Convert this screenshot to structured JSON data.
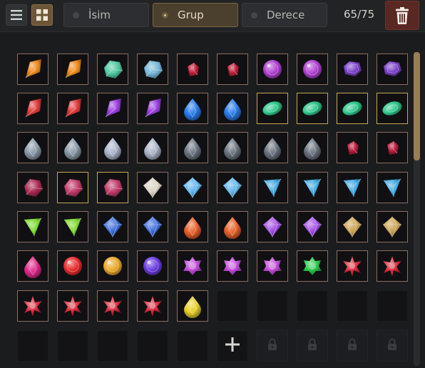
{
  "toolbar": {
    "list_view_icon": "list-icon",
    "grid_view_icon": "grid-icon",
    "sort_options": [
      {
        "label": "İsim",
        "active": false
      },
      {
        "label": "Grup",
        "active": true
      },
      {
        "label": "Derece",
        "active": false
      }
    ],
    "count": "65/75",
    "delete_icon": "trash-icon"
  },
  "colors": {
    "accent": "#8d7249",
    "delete": "#5a2822",
    "slot_border": "#8a6e60",
    "slot_highlight": "#c6a85a"
  },
  "inventory": {
    "add_slot_icon": "plus-icon",
    "locked_slot_icon": "lock-icon",
    "rows": [
      [
        {
          "name": "amber-crystal",
          "color": "#f08a1c",
          "shape": "shard"
        },
        {
          "name": "amber-crystal",
          "color": "#f08a1c",
          "shape": "shard"
        },
        {
          "name": "green-blue-ore",
          "color": "#4fc8a0",
          "shape": "chunk"
        },
        {
          "name": "blue-green-ore",
          "color": "#78b8d8",
          "shape": "chunk"
        },
        {
          "name": "dark-ruby-shard",
          "color": "#c0203a",
          "shape": "small"
        },
        {
          "name": "dark-ruby-shard",
          "color": "#c0203a",
          "shape": "small"
        },
        {
          "name": "amethyst-orb",
          "color": "#b040d0",
          "shape": "orb"
        },
        {
          "name": "amethyst-orb",
          "color": "#b040d0",
          "shape": "orb"
        },
        {
          "name": "purple-hexagon",
          "color": "#7a3ec8",
          "shape": "hex"
        },
        {
          "name": "purple-hexagon",
          "color": "#7a3ec8",
          "shape": "hex"
        }
      ],
      [
        {
          "name": "red-crystal",
          "color": "#e03a3a",
          "shape": "shard"
        },
        {
          "name": "red-crystal",
          "color": "#e03a3a",
          "shape": "shard"
        },
        {
          "name": "violet-crystal",
          "color": "#9b3fe0",
          "shape": "shard"
        },
        {
          "name": "violet-crystal",
          "color": "#9b3fe0",
          "shape": "shard"
        },
        {
          "name": "blue-teardrop",
          "color": "#2a7be8",
          "shape": "drop"
        },
        {
          "name": "blue-teardrop",
          "color": "#2a7be8",
          "shape": "drop"
        },
        {
          "name": "emerald-marquise",
          "color": "#2fc88c",
          "shape": "oval",
          "highlight": true
        },
        {
          "name": "emerald-marquise",
          "color": "#2fc88c",
          "shape": "oval",
          "highlight": true
        },
        {
          "name": "emerald-marquise",
          "color": "#2fc88c",
          "shape": "oval",
          "highlight": true
        },
        {
          "name": "emerald-marquise",
          "color": "#2fc88c",
          "shape": "oval",
          "highlight": true
        }
      ],
      [
        {
          "name": "grey-teardrop",
          "color": "#8a9aa8",
          "shape": "drop"
        },
        {
          "name": "grey-teardrop",
          "color": "#8a9aa8",
          "shape": "drop"
        },
        {
          "name": "silver-teardrop",
          "color": "#aab4c8",
          "shape": "drop"
        },
        {
          "name": "silver-teardrop",
          "color": "#aab4c8",
          "shape": "drop"
        },
        {
          "name": "dark-teardrop",
          "color": "#6c7480",
          "shape": "drop"
        },
        {
          "name": "dark-teardrop",
          "color": "#6c7480",
          "shape": "drop"
        },
        {
          "name": "dark-teardrop",
          "color": "#6c7480",
          "shape": "drop"
        },
        {
          "name": "dark-teardrop",
          "color": "#6c7480",
          "shape": "drop"
        },
        {
          "name": "blood-shards",
          "color": "#b81c3c",
          "shape": "small"
        },
        {
          "name": "blood-shards",
          "color": "#b81c3c",
          "shape": "small"
        }
      ],
      [
        {
          "name": "garnet-chunk",
          "color": "#a82850",
          "shape": "chunk"
        },
        {
          "name": "garnet-chunk",
          "color": "#c03a6a",
          "shape": "chunk",
          "highlight": true
        },
        {
          "name": "garnet-chunk",
          "color": "#c03a6a",
          "shape": "chunk",
          "highlight": true
        },
        {
          "name": "white-diamond",
          "color": "#d8d0c0",
          "shape": "diamond"
        },
        {
          "name": "blue-diamond",
          "color": "#5ab0e8",
          "shape": "diamond"
        },
        {
          "name": "blue-diamond",
          "color": "#5ab0e8",
          "shape": "diamond"
        },
        {
          "name": "cyan-trillion",
          "color": "#3ea8e0",
          "shape": "trillion"
        },
        {
          "name": "cyan-trillion",
          "color": "#3ea8e0",
          "shape": "trillion"
        },
        {
          "name": "cyan-trillion",
          "color": "#3ea8e0",
          "shape": "trillion"
        },
        {
          "name": "cyan-trillion",
          "color": "#3ea8e0",
          "shape": "trillion"
        }
      ],
      [
        {
          "name": "peridot-trillion",
          "color": "#7ad82a",
          "shape": "trillion"
        },
        {
          "name": "peridot-trillion",
          "color": "#7ad82a",
          "shape": "trillion"
        },
        {
          "name": "sapphire-cut",
          "color": "#3a6ad8",
          "shape": "diamond"
        },
        {
          "name": "sapphire-cut",
          "color": "#3a6ad8",
          "shape": "diamond"
        },
        {
          "name": "topaz-pear",
          "color": "#e8602a",
          "shape": "drop"
        },
        {
          "name": "topaz-pear",
          "color": "#e8602a",
          "shape": "drop"
        },
        {
          "name": "amethyst-cut",
          "color": "#a04ae0",
          "shape": "diamond"
        },
        {
          "name": "amethyst-cut",
          "color": "#a04ae0",
          "shape": "diamond"
        },
        {
          "name": "smoky-facet",
          "color": "#c8a050",
          "shape": "diamond"
        },
        {
          "name": "smoky-facet",
          "color": "#c8a050",
          "shape": "diamond"
        }
      ],
      [
        {
          "name": "magenta-pear",
          "color": "#e02a8a",
          "shape": "drop"
        },
        {
          "name": "ruby-round",
          "color": "#e82a2a",
          "shape": "orb"
        },
        {
          "name": "citrine-round",
          "color": "#e8a82a",
          "shape": "orb"
        },
        {
          "name": "indigo-round",
          "color": "#6a3ae0",
          "shape": "orb"
        },
        {
          "name": "orchid-cluster",
          "color": "#c04ad8",
          "shape": "flower"
        },
        {
          "name": "orchid-cluster",
          "color": "#c04ad8",
          "shape": "flower"
        },
        {
          "name": "orchid-cluster",
          "color": "#c04ad8",
          "shape": "flower"
        },
        {
          "name": "emerald-cluster",
          "color": "#2ac84a",
          "shape": "flower"
        },
        {
          "name": "ruby-star",
          "color": "#d82a3a",
          "shape": "star"
        },
        {
          "name": "ruby-star",
          "color": "#d82a3a",
          "shape": "star"
        }
      ],
      [
        {
          "name": "ruby-star",
          "color": "#d82a3a",
          "shape": "star"
        },
        {
          "name": "ruby-star",
          "color": "#d82a3a",
          "shape": "star"
        },
        {
          "name": "ruby-star",
          "color": "#d82a3a",
          "shape": "star"
        },
        {
          "name": "ruby-star",
          "color": "#d82a3a",
          "shape": "star"
        },
        {
          "name": "gold-drop",
          "color": "#e8d02a",
          "shape": "drop"
        },
        null,
        null,
        null,
        null,
        null
      ],
      [
        null,
        null,
        null,
        null,
        null,
        "add",
        "locked",
        "locked",
        "locked",
        "locked"
      ]
    ]
  }
}
